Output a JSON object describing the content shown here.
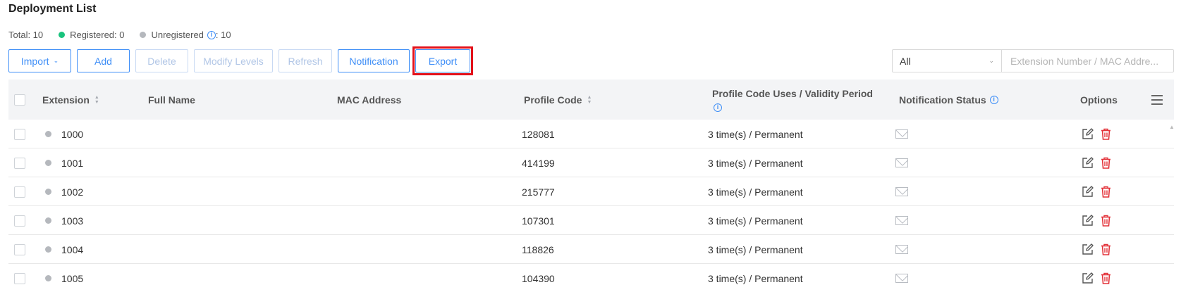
{
  "page": {
    "title": "Deployment List"
  },
  "summary": {
    "total": "Total: 10",
    "registered": "Registered: 0",
    "unregistered_label": "Unregistered",
    "unregistered_count": ": 10",
    "registered_color": "#19c37d",
    "unregistered_color": "#b5b8bd"
  },
  "toolbar": {
    "import_label": "Import",
    "add_label": "Add",
    "delete_label": "Delete",
    "modify_levels_label": "Modify Levels",
    "refresh_label": "Refresh",
    "notification_label": "Notification",
    "export_label": "Export",
    "accent_color": "#3e8ef7",
    "highlight_color": "#e3111a"
  },
  "filter": {
    "selected": "All",
    "search_placeholder": "Extension Number / MAC Addre..."
  },
  "table": {
    "columns": {
      "extension": "Extension",
      "full_name": "Full Name",
      "mac_address": "MAC Address",
      "profile_code": "Profile Code",
      "uses_validity": "Profile Code Uses / Validity Period",
      "notification_status": "Notification Status",
      "options": "Options"
    },
    "rows": [
      {
        "extension": "1000",
        "full_name": "",
        "mac": "",
        "profile_code": "128081",
        "uses": "3 time(s) / Permanent"
      },
      {
        "extension": "1001",
        "full_name": "",
        "mac": "",
        "profile_code": "414199",
        "uses": "3 time(s) / Permanent"
      },
      {
        "extension": "1002",
        "full_name": "",
        "mac": "",
        "profile_code": "215777",
        "uses": "3 time(s) / Permanent"
      },
      {
        "extension": "1003",
        "full_name": "",
        "mac": "",
        "profile_code": "107301",
        "uses": "3 time(s) / Permanent"
      },
      {
        "extension": "1004",
        "full_name": "",
        "mac": "",
        "profile_code": "118826",
        "uses": "3 time(s) / Permanent"
      },
      {
        "extension": "1005",
        "full_name": "",
        "mac": "",
        "profile_code": "104390",
        "uses": "3 time(s) / Permanent"
      }
    ],
    "status_dot_color": "#b5b8bd",
    "delete_color": "#e3333a"
  }
}
